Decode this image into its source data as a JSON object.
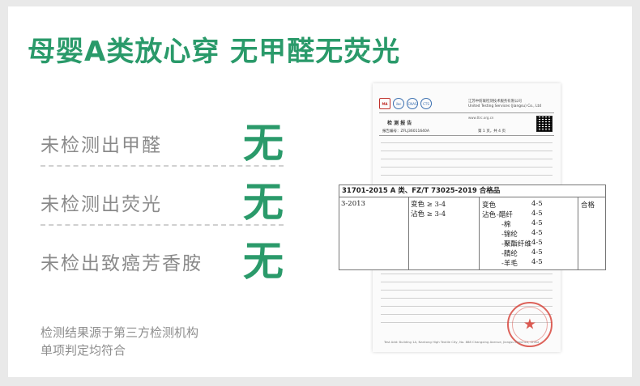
{
  "headline": "母婴A类放心穿 无甲醛无荧光",
  "rows": [
    {
      "label": "未检测出甲醛",
      "mark": "无"
    },
    {
      "label": "未检测出荧光",
      "mark": "无"
    },
    {
      "label": "未检出致癌芳香胺",
      "mark": "无"
    }
  ],
  "note": {
    "line1": "检测结果源于第三方检测机构",
    "line2": "单项判定均符合"
  },
  "report": {
    "logos": [
      "MA",
      "ilac",
      "CNAS",
      "CTS"
    ],
    "company_cn": "江苏中纺联检测技术服务有限公司",
    "company_en": "United Testing Services (Jiangsu) Co., Ltd",
    "title": "检 测 报 告",
    "contact": "www.ttrc.org.cn",
    "report_no": "报告编号：ZFLJ36011640A",
    "page_no": "第 1 页，共 4 页",
    "footer": "Test Add: Building 1A, Nantong High Textile City, No. 888 Changxing Avenue, Jiangsu Province, China"
  },
  "zoom": {
    "header": "31701-2015 A 类、FZ/T 73025-2019 合格品",
    "standard": "3-2013",
    "requirements": [
      "变色 ≥ 3-4",
      "沾色 ≥ 3-4"
    ],
    "items": [
      "变色",
      "沾色",
      "-醋纤",
      "-棉",
      "-锦纶",
      "-聚酯纤维",
      "-腈纶",
      "-羊毛"
    ],
    "values": [
      "4-5",
      "",
      "4-5",
      "4-5",
      "4-5",
      "4-5",
      "4-5",
      "4-5"
    ],
    "result": "合格"
  }
}
